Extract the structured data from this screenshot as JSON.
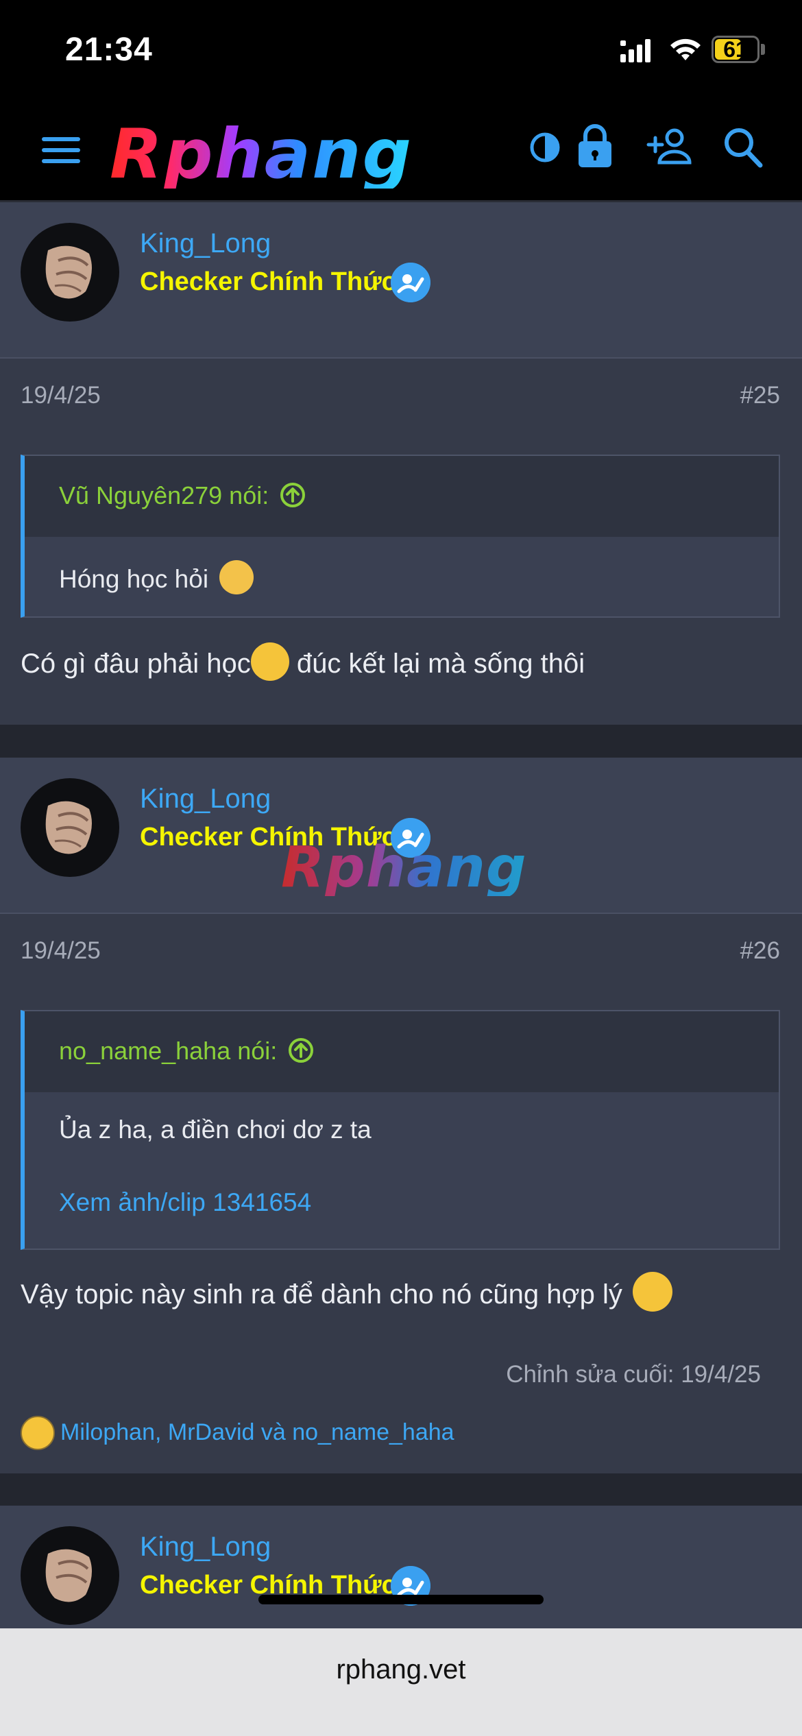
{
  "status_bar": {
    "time": "21:34",
    "battery": "61"
  },
  "header": {
    "logo_text": "Rphang",
    "icons": [
      "menu-icon",
      "contrast-icon",
      "lock-icon",
      "add-user-icon",
      "search-icon"
    ]
  },
  "posts": [
    {
      "username": "King_Long",
      "role": "Checker Chính Thức",
      "date": "19/4/25",
      "number": "#25",
      "quote_author": "Vũ Nguyên279 nói:",
      "quote_text": "Hóng học hỏi",
      "body": "Có gì đâu phải học",
      "body_tail": " đúc kết lại mà sống thôi"
    },
    {
      "username": "King_Long",
      "role": "Checker Chính Thức",
      "date": "19/4/25",
      "number": "#26",
      "quote_author": "no_name_haha nói:",
      "quote_text": "Ủa z ha, a điền chơi dơ z ta",
      "quote_link": "Xem ảnh/clip 1341654",
      "body": "Vậy topic này sinh ra để dành cho nó cũng hợp lý",
      "edited": "Chỉnh sửa cuối: 19/4/25",
      "reactions": "Milophan, MrDavid và no_name_haha"
    },
    {
      "username": "King_Long",
      "role": "Checker Chính Thức"
    }
  ],
  "watermark": "Rphang",
  "browser": {
    "url": "rphang.vet"
  },
  "colors": {
    "accent": "#3da8f5",
    "role": "#f5f500",
    "quote_author": "#8bd13a",
    "background": "#23262f"
  }
}
